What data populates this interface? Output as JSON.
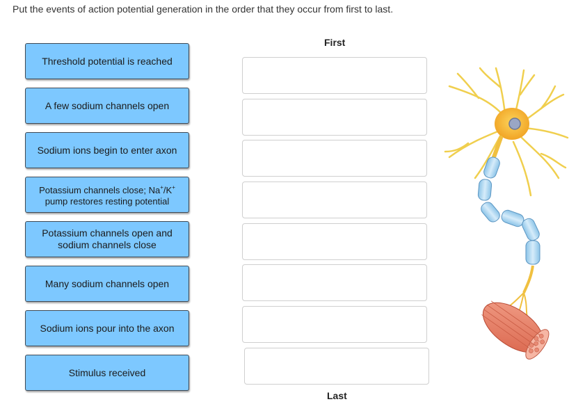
{
  "instruction": "Put the events of action potential generation in the order that they occur from first to last.",
  "items": [
    {
      "text": "Threshold potential is reached"
    },
    {
      "text": "A few sodium channels open"
    },
    {
      "text": "Sodium ions begin to enter axon"
    },
    {
      "text_before": "Potassium channels close; Na",
      "sup1": "+",
      "text_mid": "/K",
      "sup2": "+",
      "text_after": " pump restores resting potential"
    },
    {
      "text": "Potassium channels open and sodium channels close"
    },
    {
      "text": "Many sodium channels open"
    },
    {
      "text": "Sodium ions pour into the axon"
    },
    {
      "text": "Stimulus received"
    }
  ],
  "slots": {
    "count": 8
  },
  "labels": {
    "first": "First",
    "last": "Last"
  },
  "image": {
    "subject": "neuron-illustration",
    "colors": {
      "cell_body": "#f5b233",
      "dendrites": "#f2d04a",
      "myelin": "#a9d4ee",
      "muscle": "#e77a5e"
    }
  },
  "colors": {
    "tile_bg": "#7dc8ff",
    "tile_border": "#3f4a55",
    "slot_border": "#cfcfcf"
  }
}
